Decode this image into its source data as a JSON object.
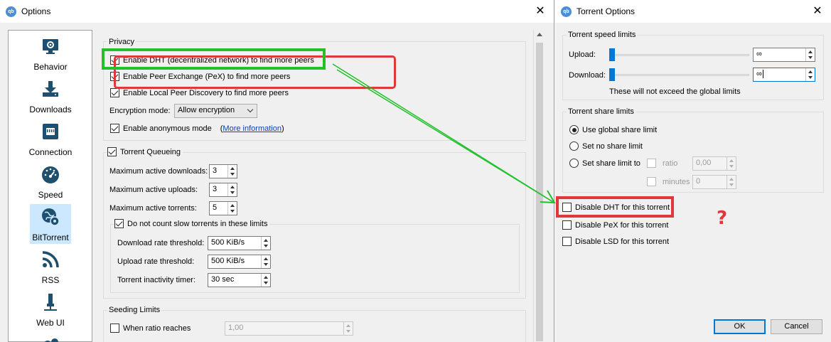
{
  "options": {
    "title": "Options",
    "sidebar": [
      {
        "label": "Behavior",
        "icon": "monitor-gear-icon",
        "selected": false
      },
      {
        "label": "Downloads",
        "icon": "download-tray-icon",
        "selected": false
      },
      {
        "label": "Connection",
        "icon": "network-port-icon",
        "selected": false
      },
      {
        "label": "Speed",
        "icon": "speedometer-icon",
        "selected": false
      },
      {
        "label": "BitTorrent",
        "icon": "globe-gear-icon",
        "selected": true
      },
      {
        "label": "RSS",
        "icon": "rss-feed-icon",
        "selected": false
      },
      {
        "label": "Web UI",
        "icon": "usb-plug-icon",
        "selected": false
      }
    ],
    "privacy": {
      "title": "Privacy",
      "dht": {
        "label": "Enable DHT (decentralized network) to find more peers",
        "checked": true
      },
      "pex": {
        "label": "Enable Peer Exchange (PeX) to find more peers",
        "checked": true
      },
      "lsd": {
        "label": "Enable Local Peer Discovery to find more peers",
        "checked": true
      },
      "encryption_label": "Encryption mode:",
      "encryption_value": "Allow encryption",
      "anon": {
        "label": "Enable anonymous mode",
        "checked": true
      },
      "anon_paren_open": "(",
      "more_info": "More information",
      "anon_paren_close": ")"
    },
    "queueing": {
      "title": "Torrent Queueing",
      "checked": true,
      "max_downloads_label": "Maximum active downloads:",
      "max_downloads": "3",
      "max_uploads_label": "Maximum active uploads:",
      "max_uploads": "3",
      "max_torrents_label": "Maximum active torrents:",
      "max_torrents": "5",
      "slow": {
        "label": "Do not count slow torrents in these limits",
        "checked": true,
        "dl_rate_label": "Download rate threshold:",
        "dl_rate": "500 KiB/s",
        "ul_rate_label": "Upload rate threshold:",
        "ul_rate": "500 KiB/s",
        "inactivity_label": "Torrent inactivity timer:",
        "inactivity": "30 sec"
      }
    },
    "seeding": {
      "title": "Seeding Limits",
      "ratio_label": "When ratio reaches",
      "ratio_checked": false,
      "ratio_value": "1,00"
    }
  },
  "torrent": {
    "title": "Torrent Options",
    "speed": {
      "title": "Torrent speed limits",
      "upload_label": "Upload:",
      "upload_value": "∞",
      "download_label": "Download:",
      "download_value": "∞",
      "note": "These will not exceed the global limits"
    },
    "share": {
      "title": "Torrent share limits",
      "global": "Use global share limit",
      "none": "Set no share limit",
      "set_to": "Set share limit to",
      "ratio_label": "ratio",
      "ratio_value": "0,00",
      "minutes_label": "minutes",
      "minutes_value": "0",
      "selected": "global"
    },
    "disable_dht": "Disable DHT for this torrent",
    "disable_pex": "Disable PeX for this torrent",
    "disable_lsd": "Disable LSD for this torrent",
    "ok": "OK",
    "cancel": "Cancel"
  },
  "annotation": {
    "question_mark": "?",
    "highlight_green": "#22c02a",
    "highlight_red": "#e0383a"
  },
  "colors": {
    "accent": "#0078d7",
    "selection": "#cce8ff",
    "link": "#0645ad"
  }
}
